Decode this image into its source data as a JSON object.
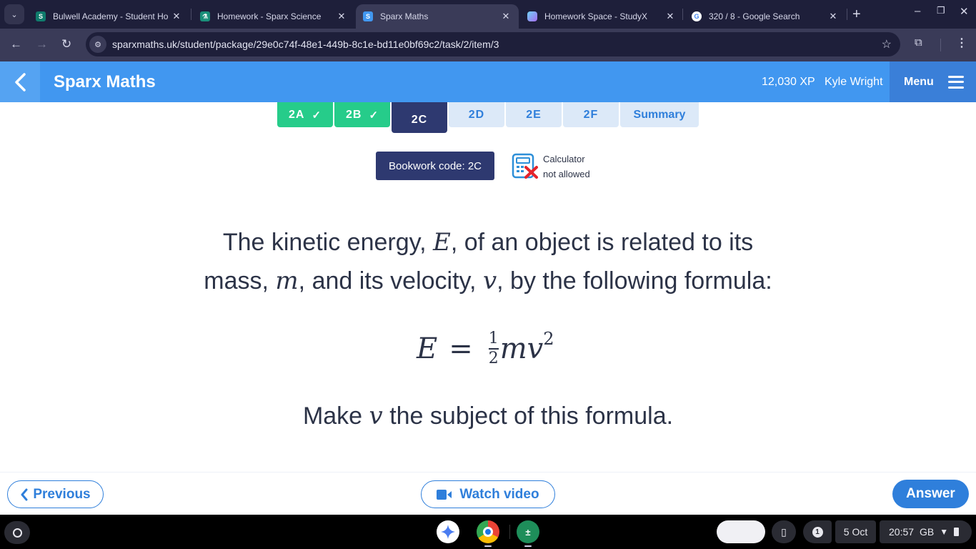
{
  "browser": {
    "tabs": [
      {
        "title": "Bulwell Academy - Student Ho",
        "favicon": "sharepoint-icon",
        "color": "#0f7b6c",
        "active": false
      },
      {
        "title": "Homework - Sparx Science",
        "favicon": "flask-icon",
        "color": "#1a8f7a",
        "active": false
      },
      {
        "title": "Sparx Maths",
        "favicon": "sparx-icon",
        "color": "#4197f0",
        "active": true
      },
      {
        "title": "Homework Space - StudyX",
        "favicon": "studyx-icon",
        "color": "#8a6cf0",
        "active": false
      },
      {
        "title": "320 / 8 - Google Search",
        "favicon": "google-icon",
        "color": "#ffffff",
        "active": false
      }
    ],
    "close_glyph": "✕",
    "new_tab_glyph": "+",
    "url": "sparxmaths.uk/student/package/29e0c74f-48e1-449b-8c1e-bd11e0bf69c2/task/2/item/3"
  },
  "header": {
    "title": "Sparx Maths",
    "xp": "12,030 XP",
    "user": "Kyle Wright",
    "menu_label": "Menu"
  },
  "task_tabs": [
    {
      "label": "2A",
      "state": "done"
    },
    {
      "label": "2B",
      "state": "done"
    },
    {
      "label": "2C",
      "state": "current"
    },
    {
      "label": "2D",
      "state": "pending"
    },
    {
      "label": "2E",
      "state": "pending"
    },
    {
      "label": "2F",
      "state": "pending"
    },
    {
      "label": "Summary",
      "state": "pending"
    }
  ],
  "bookwork": {
    "label": "Bookwork code: 2C"
  },
  "calculator": {
    "line1": "Calculator",
    "line2": "not allowed"
  },
  "question": {
    "line1_a": "The kinetic energy, ",
    "var_E": "E",
    "line1_b": ", of an object is related to its",
    "line2_a": "mass, ",
    "var_m": "m",
    "line2_b": ", and its velocity, ",
    "var_v": "v",
    "line2_c": ", by the following formula:",
    "formula": {
      "lhs": "E",
      "eq": "=",
      "num": "1",
      "den": "2",
      "rhs": "mv",
      "exp": "2"
    },
    "prompt_a": "Make ",
    "prompt_var": "v",
    "prompt_b": " the subject of this formula."
  },
  "footer": {
    "previous": "Previous",
    "watch_video": "Watch video",
    "answer": "Answer"
  },
  "shelf": {
    "date": "5 Oct",
    "time": "20:57",
    "locale": "GB",
    "notification_count": "1"
  },
  "colors": {
    "brand": "#4197f0",
    "done": "#26cc8a",
    "current": "#2e3970",
    "pending_bg": "#dce9f8",
    "accent": "#2f7fdb"
  }
}
